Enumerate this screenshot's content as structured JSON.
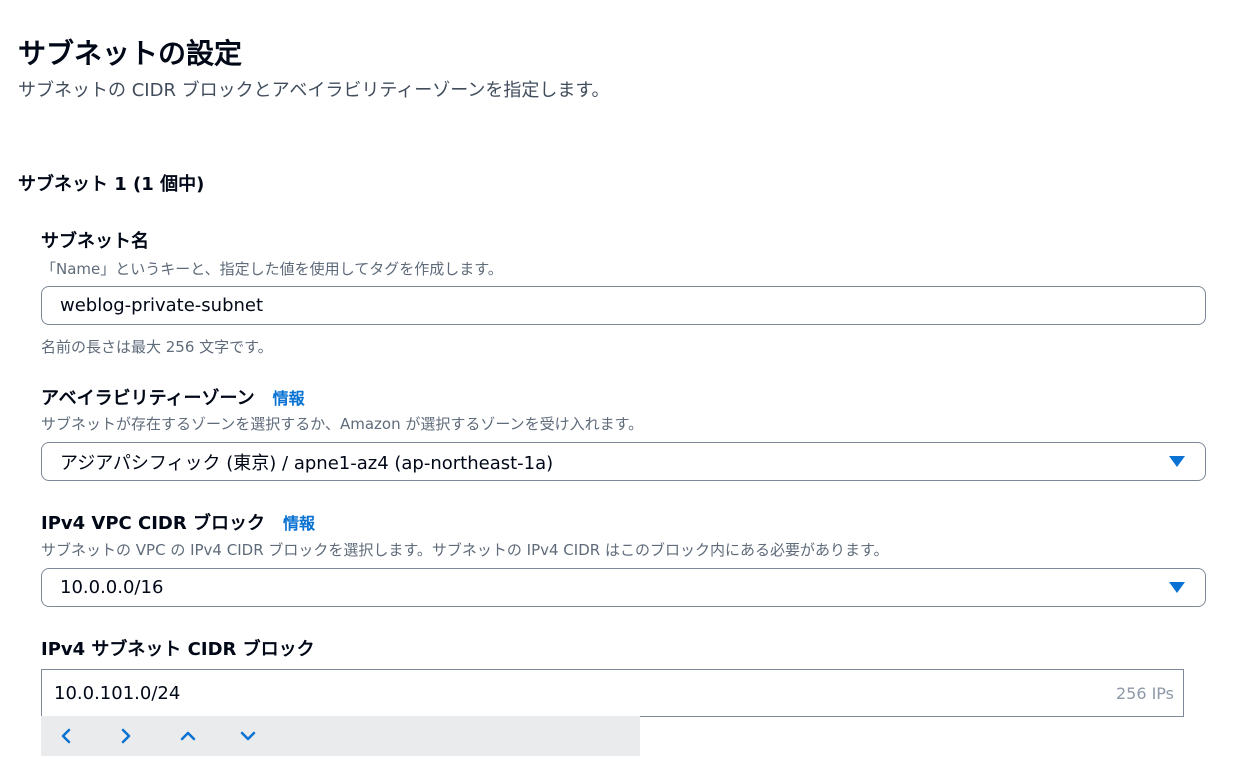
{
  "page": {
    "title": "サブネットの設定",
    "subtitle": "サブネットの CIDR ブロックとアベイラビリティーゾーンを指定します。"
  },
  "subnet": {
    "heading": "サブネット 1 (1 個中)",
    "name": {
      "label": "サブネット名",
      "description": "「Name」というキーと、指定した値を使用してタグを作成します。",
      "value": "weblog-private-subnet",
      "constraint": "名前の長さは最大 256 文字です。"
    },
    "az": {
      "label": "アベイラビリティーゾーン",
      "info": "情報",
      "description": "サブネットが存在するゾーンを選択するか、Amazon が選択するゾーンを受け入れます。",
      "value": "アジアパシフィック (東京) / apne1-az4 (ap-northeast-1a)"
    },
    "vpc_cidr": {
      "label": "IPv4 VPC CIDR ブロック",
      "info": "情報",
      "description": "サブネットの VPC の IPv4 CIDR ブロックを選択します。サブネットの IPv4 CIDR はこのブロック内にある必要があります。",
      "value": "10.0.0.0/16"
    },
    "subnet_cidr": {
      "label": "IPv4 サブネット CIDR ブロック",
      "value": "10.0.101.0/24",
      "ip_count": "256 IPs"
    }
  },
  "colors": {
    "accent": "#0972d3",
    "text": "#000716",
    "muted": "#5f6b7a",
    "border": "#7d8998",
    "stepper_bg": "#e9ebed"
  },
  "icons": {
    "select_caret": "caret-down-icon",
    "steppers": [
      "chevron-left-icon",
      "chevron-right-icon",
      "chevron-up-icon",
      "chevron-down-icon"
    ]
  }
}
